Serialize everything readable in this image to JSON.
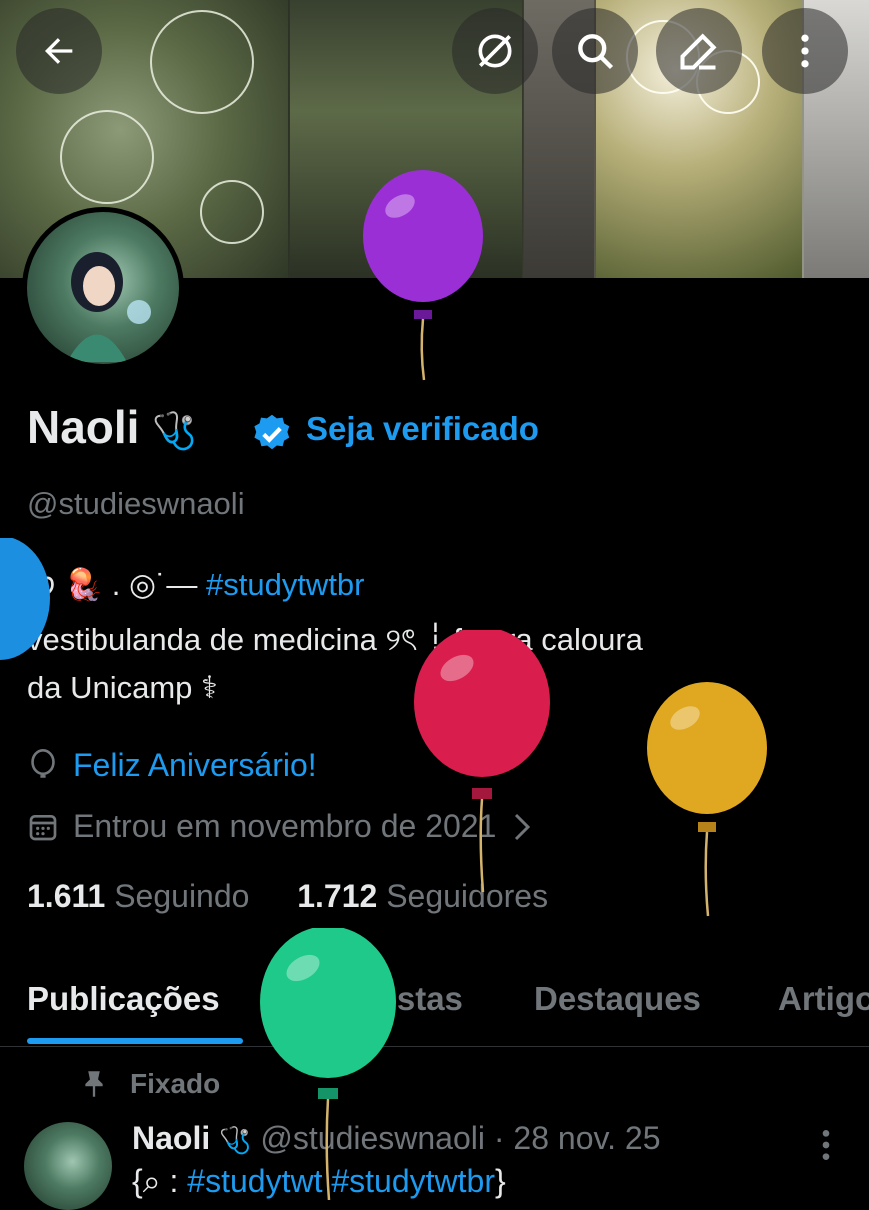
{
  "header": {
    "back_icon": "arrow-left-icon",
    "actions": [
      "grok-icon",
      "search-icon",
      "edit-icon",
      "more-vertical-icon"
    ]
  },
  "profile": {
    "name": "Naoli",
    "name_emoji": "🩺",
    "verify_cta": "Seja verificado",
    "handle": "@studieswnaoli",
    "bio_line1_prefix": "  ᰔ 🪼 . ◎˙—",
    "bio_hashtag": "#studytwtbr",
    "bio_line2": "vestibulanda de medicina ୨ৎ ┆ futura caloura",
    "bio_line3": "da Unicamp ⚕",
    "birthday": "Feliz Aniversário!",
    "joined": "Entrou em novembro de 2021",
    "following_count": "1.611",
    "following_label": "Seguindo",
    "followers_count": "1.712",
    "followers_label": "Seguidores"
  },
  "tabs": [
    "Publicações",
    "Respostas",
    "Destaques",
    "Artigos"
  ],
  "active_tab": "Publicações",
  "pinned_post": {
    "pinned_label": "Fixado",
    "author": "Naoli",
    "author_emoji": "🩺",
    "handle": "@studieswnaoli",
    "separator": "·",
    "date": "28 nov. 25",
    "text_prefix": "{⌕ :",
    "hashtag1": "#studytwt",
    "hashtag2": "#studytwtbr",
    "text_suffix": "}"
  },
  "colors": {
    "accent": "#1d9bf0",
    "muted": "#71767b",
    "balloon_purple": "#9b2fd6",
    "balloon_red": "#d91e4e",
    "balloon_yellow": "#e0a820",
    "balloon_green": "#1fc98a",
    "balloon_blue": "#1d8fe0"
  }
}
